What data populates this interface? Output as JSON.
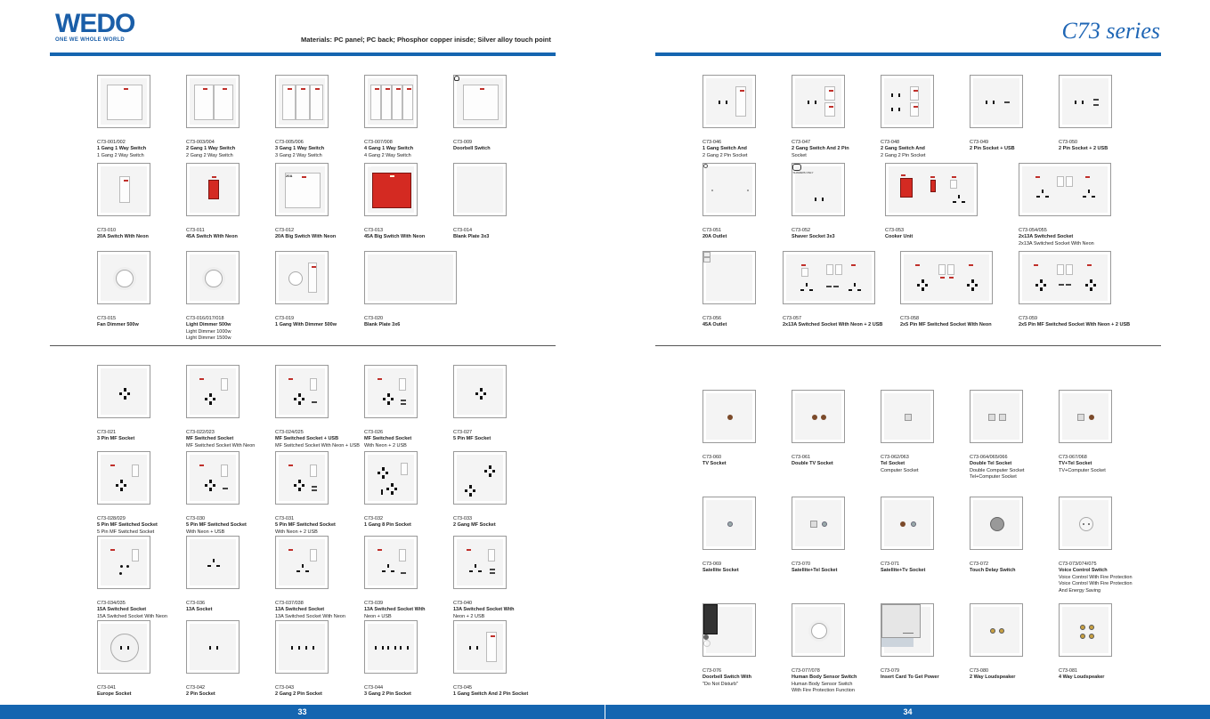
{
  "header": {
    "brand": "WEDO",
    "tagline": "ONE WE WHOLE WORLD",
    "materials": "Materials: PC panel; PC back; Phosphor copper inisde; Silver alloy touch point",
    "series": "C73 series"
  },
  "pages": {
    "left": "33",
    "right": "34"
  },
  "items": [
    {
      "code": "C73-001/002",
      "lines": [
        "1 Gang 1 Way Switch",
        "1 Gang 2 Way Switch"
      ]
    },
    {
      "code": "C73-003/004",
      "lines": [
        "2 Gang 1 Way Switch",
        "2 Gang 2 Way Switch"
      ]
    },
    {
      "code": "C73-005/006",
      "lines": [
        "3 Gang 1 Way Switch",
        "3 Gang 2 Way Switch"
      ]
    },
    {
      "code": "C73-007/008",
      "lines": [
        "4 Gang 1 Way Switch",
        "4 Gang 2 Way Switch"
      ]
    },
    {
      "code": "C73-009",
      "lines": [
        "Doorbell Switch"
      ]
    },
    {
      "code": "C73-010",
      "lines": [
        "20A Switch With Neon"
      ]
    },
    {
      "code": "C73-011",
      "lines": [
        "45A Switch With Neon"
      ]
    },
    {
      "code": "C73-012",
      "lines": [
        "20A Big Switch With Neon"
      ],
      "label": "20A"
    },
    {
      "code": "C73-013",
      "lines": [
        "45A Big Switch With Neon"
      ],
      "label": "45A"
    },
    {
      "code": "C73-014",
      "lines": [
        "Blank Plate 3x3"
      ]
    },
    {
      "code": "C73-015",
      "lines": [
        "Fan Dimmer 500w"
      ]
    },
    {
      "code": "C73-016/017/018",
      "lines": [
        "Light Dimmer 500w",
        "Light Dimmer 1000w",
        "Light Dimmer 1500w"
      ]
    },
    {
      "code": "C73-019",
      "lines": [
        "1 Gang With Dimmer 500w"
      ]
    },
    {
      "code": "C73-020",
      "lines": [
        "Blank Plate 3x6"
      ]
    },
    {
      "code": "C73-021",
      "lines": [
        "3 Pin MF Socket"
      ]
    },
    {
      "code": "C73-022/023",
      "lines": [
        "MF Switched Socket",
        "MF Switched Socket With Neon"
      ]
    },
    {
      "code": "C73-024/025",
      "lines": [
        "MF Switched Socket + USB",
        "MF Switched Socket With Neon + USB"
      ]
    },
    {
      "code": "C73-026",
      "lines": [
        "MF Switched Socket",
        "With Neon + 2 USB"
      ]
    },
    {
      "code": "C73-027",
      "lines": [
        "5 Pin MF Socket"
      ]
    },
    {
      "code": "C73-028/029",
      "lines": [
        "5 Pin MF Switched Socket",
        "5 Pin MF Switched Socket",
        "With Neon"
      ]
    },
    {
      "code": "C73-030",
      "lines": [
        "5 Pin MF Switched Socket",
        "With Neon + USB"
      ]
    },
    {
      "code": "C73-031",
      "lines": [
        "5 Pin MF Switched Socket",
        "With Neon + 2 USB"
      ]
    },
    {
      "code": "C73-032",
      "lines": [
        "1 Gang 8 Pin Socket"
      ]
    },
    {
      "code": "C73-033",
      "lines": [
        "2 Gang MF Socket"
      ]
    },
    {
      "code": "C73-034/035",
      "lines": [
        "15A Switched Socket",
        "15A Switched Socket With Neon"
      ]
    },
    {
      "code": "C73-036",
      "lines": [
        "13A Socket"
      ]
    },
    {
      "code": "C73-037/038",
      "lines": [
        "13A Switched Socket",
        "13A Switched Socket With Neon"
      ]
    },
    {
      "code": "C73-039",
      "lines": [
        "13A Switched Socket With",
        "Neon + USB"
      ]
    },
    {
      "code": "C73-040",
      "lines": [
        "13A Switched Socket With",
        "Neon + 2 USB"
      ]
    },
    {
      "code": "C73-041",
      "lines": [
        "Europe Socket"
      ]
    },
    {
      "code": "C73-042",
      "lines": [
        "2 Pin Socket"
      ]
    },
    {
      "code": "C73-043",
      "lines": [
        "2 Gang 2 Pin Socket"
      ]
    },
    {
      "code": "C73-044",
      "lines": [
        "3 Gang 2 Pin Socket"
      ]
    },
    {
      "code": "C73-045",
      "lines": [
        "1 Gang Switch And 2 Pin Socket"
      ]
    },
    {
      "code": "C73-046",
      "lines": [
        "1 Gang Switch And",
        "2 Gang 2 Pin Socket"
      ]
    },
    {
      "code": "C73-047",
      "lines": [
        "2 Gang Switch And 2 Pin",
        "Socket"
      ]
    },
    {
      "code": "C73-048",
      "lines": [
        "2 Gang Switch And",
        "2 Gang 2 Pin Socket"
      ]
    },
    {
      "code": "C73-049",
      "lines": [
        "2 Pin Socket + USB"
      ]
    },
    {
      "code": "C73-050",
      "lines": [
        "2 Pin Socket + 2 USB"
      ]
    },
    {
      "code": "C73-051",
      "lines": [
        "20A Outlet"
      ]
    },
    {
      "code": "C73-052",
      "lines": [
        "Shaver Socket 3x3"
      ],
      "label": "SHAVERS ONLY"
    },
    {
      "code": "C73-053",
      "lines": [
        "Cooker Unit"
      ]
    },
    {
      "code": "C73-054/055",
      "lines": [
        "2x13A Switched Socket",
        "2x13A Switched Socket With Neon"
      ]
    },
    {
      "code": "C73-056",
      "lines": [
        "45A Outlet"
      ]
    },
    {
      "code": "C73-057",
      "lines": [
        "2x13A Switched Socket With Neon + 2 USB"
      ]
    },
    {
      "code": "C73-058",
      "lines": [
        "2x5 Pin MF Switched Socket With Neon"
      ]
    },
    {
      "code": "C73-059",
      "lines": [
        "2x5 Pin MF Switched Socket With Neon + 2 USB"
      ]
    },
    {
      "code": "C73-060",
      "lines": [
        "TV Socket"
      ]
    },
    {
      "code": "C73-061",
      "lines": [
        "Double TV Socket"
      ]
    },
    {
      "code": "C73-062/063",
      "lines": [
        "Tel Socket",
        "Computer Socket"
      ]
    },
    {
      "code": "C73-064/065/066",
      "lines": [
        "Double Tel Socket",
        "Double Computer Socket",
        "Tel+Computer Socket"
      ]
    },
    {
      "code": "C73-067/068",
      "lines": [
        "TV+Tel Socket",
        "TV+Computer Socket"
      ]
    },
    {
      "code": "C73-069",
      "lines": [
        "Satellite Socket"
      ]
    },
    {
      "code": "C73-070",
      "lines": [
        "Satellite+Tel Socket"
      ]
    },
    {
      "code": "C73-071",
      "lines": [
        "Satellite+Tv Socket"
      ]
    },
    {
      "code": "C73-072",
      "lines": [
        "Touch Delay Switch"
      ]
    },
    {
      "code": "C73-073/074/075",
      "lines": [
        "Voice Control Switch",
        "Voice Control With Fire Protection",
        "Voice Control With Fire Protection",
        "And Energy Saving"
      ]
    },
    {
      "code": "C73-076",
      "lines": [
        "Doorbell Switch With",
        "\"Do Not Disturb\""
      ]
    },
    {
      "code": "C73-077/078",
      "lines": [
        "Human Body Sensor Switch",
        "Human Body Sensor Switch",
        "With Fire Protection Function"
      ]
    },
    {
      "code": "C73-079",
      "lines": [
        "Insert Card To Get Power"
      ]
    },
    {
      "code": "C73-080",
      "lines": [
        "2 Way Loudspeaker"
      ]
    },
    {
      "code": "C73-081",
      "lines": [
        "4 Way Loudspeaker"
      ]
    }
  ]
}
